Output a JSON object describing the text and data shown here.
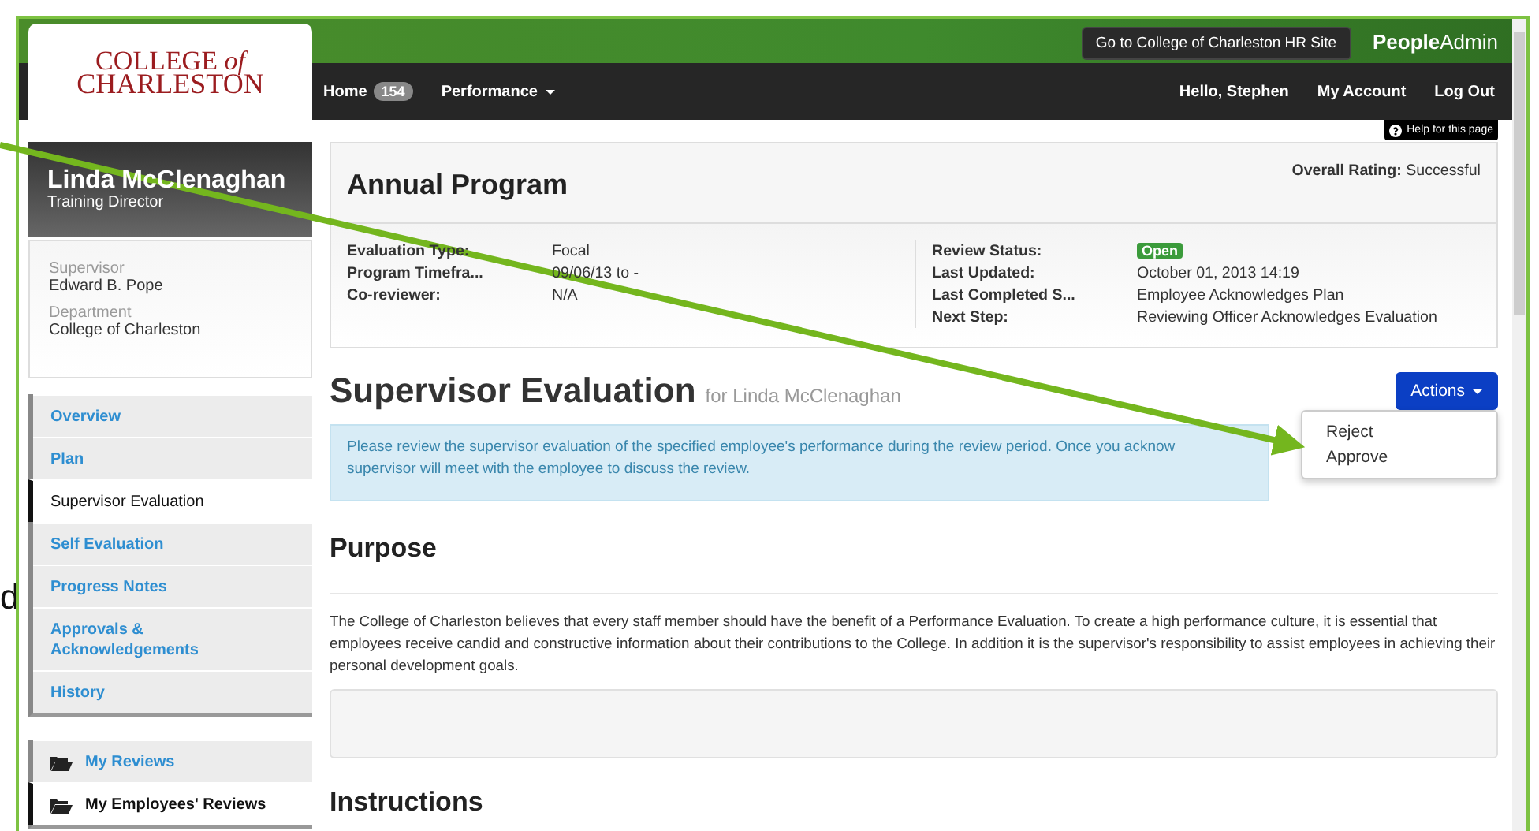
{
  "stray_text": "d",
  "header": {
    "logo_line1": "COLLEGE *of*",
    "logo_line2": "CHARLESTON",
    "hr_link": "Go to College of Charleston HR Site",
    "brand_bold": "People",
    "brand_light": "Admin"
  },
  "nav": [
    {
      "label": "Home",
      "badge": "154",
      "has_menu": false
    },
    {
      "label": "Performance",
      "has_menu": true
    }
  ],
  "user_nav": [
    "Hello, Stephen",
    "My Account",
    "Log Out"
  ],
  "help": "Help for this page",
  "profile": {
    "name": "Linda McClenaghan",
    "title": "Training Director",
    "fields": [
      {
        "label": "Supervisor",
        "value": "Edward B. Pope"
      },
      {
        "label": "Department",
        "value": "College of Charleston"
      }
    ]
  },
  "sidebar": {
    "items": [
      {
        "label": "Overview",
        "selected": false
      },
      {
        "label": "Plan",
        "selected": false
      },
      {
        "label": "Supervisor Evaluation",
        "selected": true
      },
      {
        "label": "Self Evaluation",
        "selected": false
      },
      {
        "label": "Progress Notes",
        "selected": false
      },
      {
        "label": "Approvals & Acknowledgements",
        "selected": false
      },
      {
        "label": "History",
        "selected": false
      }
    ],
    "reviews": [
      {
        "label": "My Reviews",
        "selected": false
      },
      {
        "label": "My Employees' Reviews",
        "selected": true
      }
    ]
  },
  "program": {
    "title": "Annual Program",
    "rating_label": "Overall Rating:",
    "rating_value": "Successful",
    "left_fields": [
      {
        "label": "Evaluation Type:",
        "value": "Focal",
        "kind": "text"
      },
      {
        "label": "Program Timefra...",
        "value": "09/06/13 to -",
        "kind": "text"
      },
      {
        "label": "Co-reviewer:",
        "value": "N/A",
        "kind": "text"
      }
    ],
    "right_fields": [
      {
        "label": "Review Status:",
        "value": "Open",
        "kind": "badge"
      },
      {
        "label": "Last Updated:",
        "value": "October 01, 2013 14:19",
        "kind": "text"
      },
      {
        "label": "Last Completed S...",
        "value": "Employee Acknowledges Plan",
        "kind": "text"
      },
      {
        "label": "Next Step:",
        "value": "Reviewing Officer Acknowledges Evaluation",
        "kind": "text"
      }
    ]
  },
  "evaluation": {
    "title": "Supervisor Evaluation",
    "subtitle": "for Linda McClenaghan",
    "actions_button": "Actions",
    "menu": [
      "Reject",
      "Approve"
    ],
    "alert_lines": [
      "Please review the supervisor evaluation of the specified employee's performance during the review period. Once you acknow",
      "supervisor will meet with the employee to discuss the review."
    ],
    "purpose_heading": "Purpose",
    "purpose_text": "The College of Charleston believes that every staff member should have the benefit of a Performance Evaluation. To create a high performance culture, it is essential that employees receive candid and constructive information about their contributions to the College. In addition it is the supervisor's responsibility to assist employees in achieving their personal development goals.",
    "instructions_heading": "Instructions"
  }
}
